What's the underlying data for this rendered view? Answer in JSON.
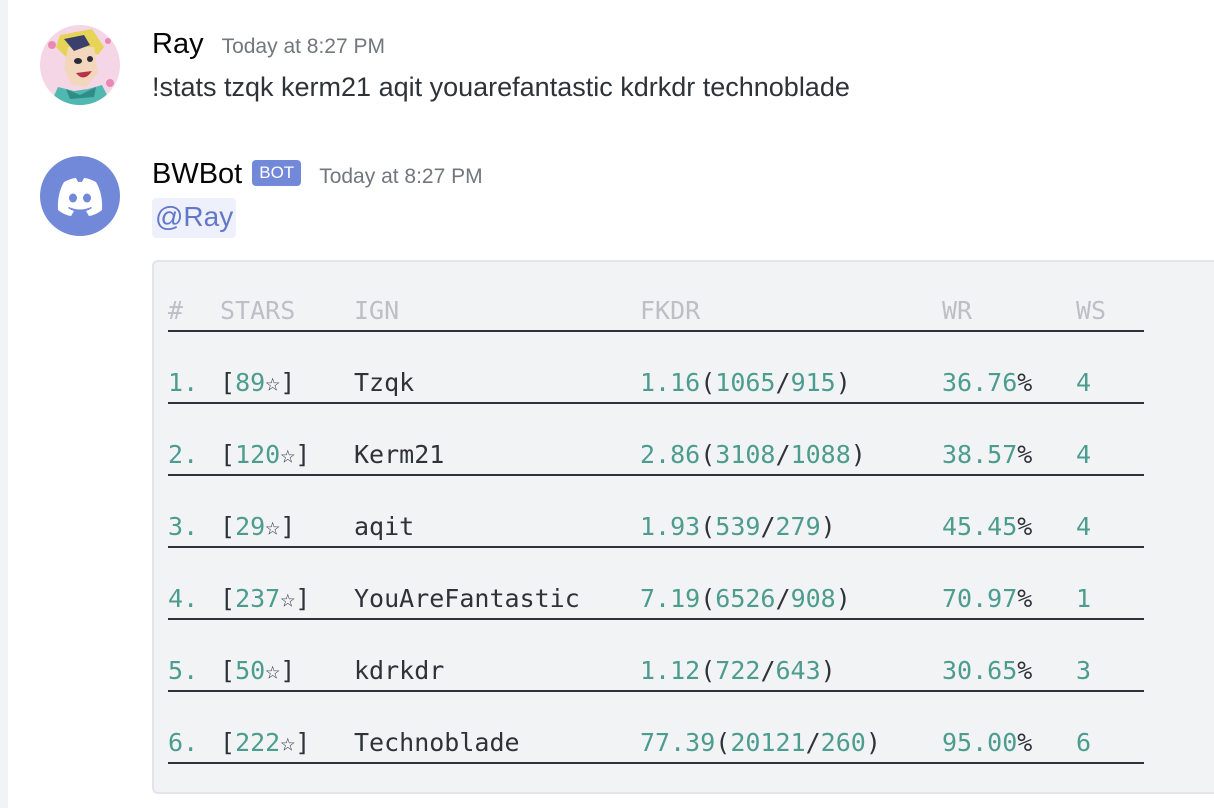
{
  "messages": [
    {
      "username": "Ray",
      "timestamp": "Today at 8:27 PM",
      "content": "!stats tzqk kerm21 aqit youarefantastic kdrkdr technoblade",
      "avatar_icon": "anime-character-avatar"
    },
    {
      "username": "BWBot",
      "bot_tag": "BOT",
      "timestamp": "Today at 8:27 PM",
      "mention": "@Ray",
      "avatar_icon": "discord-logo-icon",
      "avatar_color": "#7289da"
    }
  ],
  "stats_table": {
    "headers": [
      "#",
      "STARS",
      "IGN",
      "FKDR",
      "WR",
      "WS"
    ],
    "rows": [
      {
        "num": "1",
        "stars": "89",
        "ign": "Tzqk",
        "fkdr": "1.16",
        "finals": "1065",
        "deaths": "915",
        "wr": "36.76",
        "ws": "4"
      },
      {
        "num": "2",
        "stars": "120",
        "ign": "Kerm21",
        "fkdr": "2.86",
        "finals": "3108",
        "deaths": "1088",
        "wr": "38.57",
        "ws": "4"
      },
      {
        "num": "3",
        "stars": "29",
        "ign": "aqit",
        "fkdr": "1.93",
        "finals": "539",
        "deaths": "279",
        "wr": "45.45",
        "ws": "4"
      },
      {
        "num": "4",
        "stars": "237",
        "ign": "YouAreFantastic",
        "fkdr": "7.19",
        "finals": "6526",
        "deaths": "908",
        "wr": "70.97",
        "ws": "1"
      },
      {
        "num": "5",
        "stars": "50",
        "ign": "kdrkdr",
        "fkdr": "1.12",
        "finals": "722",
        "deaths": "643",
        "wr": "30.65",
        "ws": "3"
      },
      {
        "num": "6",
        "stars": "222",
        "ign": "Technoblade",
        "fkdr": "77.39",
        "finals": "20121",
        "deaths": "260",
        "wr": "95.00",
        "ws": "6"
      }
    ],
    "star_symbol": "☆",
    "percent_symbol": "%",
    "colors": {
      "number": "#4c9c8f",
      "text": "#2e3338",
      "header": "#bcc0c6"
    }
  }
}
